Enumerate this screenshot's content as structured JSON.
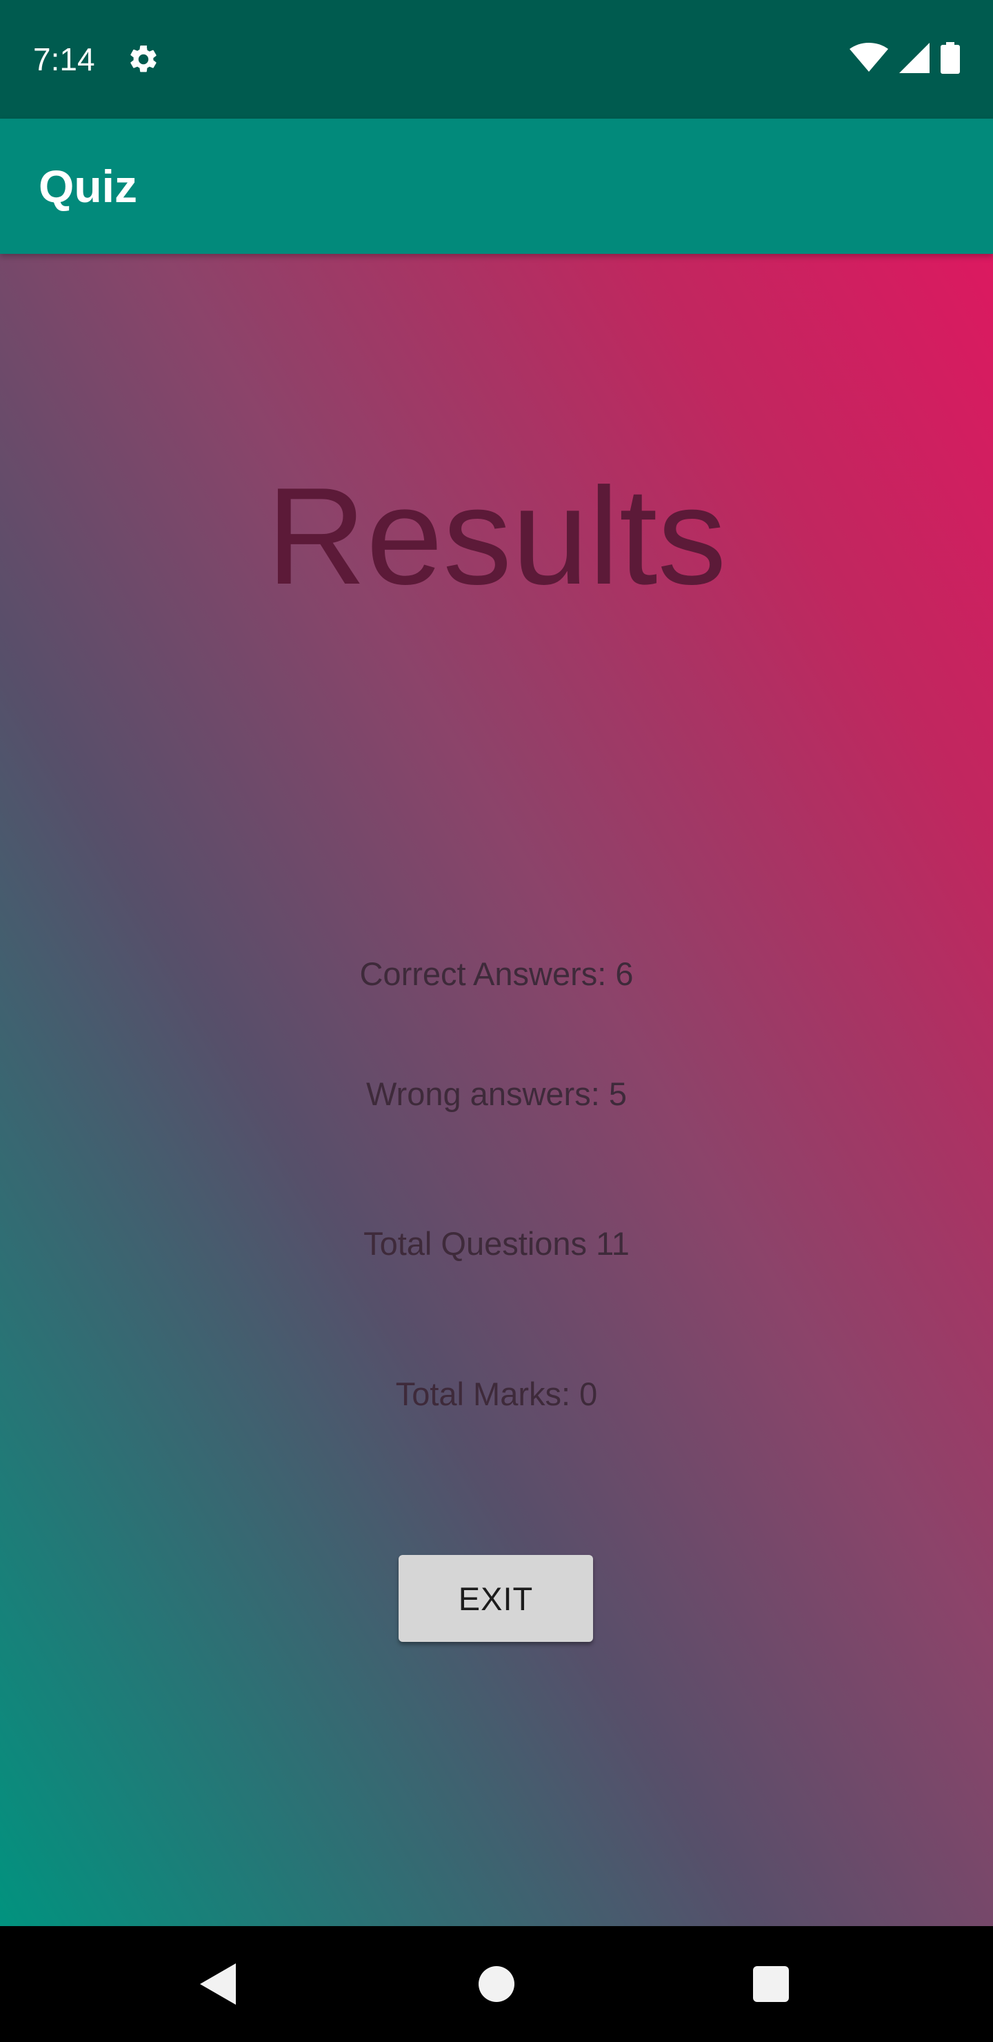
{
  "status_bar": {
    "time": "7:14",
    "icons": [
      "settings-gear-icon",
      "wifi-icon",
      "cell-signal-icon",
      "battery-icon"
    ]
  },
  "app_bar": {
    "title": "Quiz"
  },
  "results": {
    "title": "Results",
    "correct_answers": "Correct Answers: 6",
    "wrong_answers": "Wrong answers: 5",
    "total_questions": "Total Questions 11",
    "total_marks": "Total Marks: 0",
    "exit_label": "EXIT"
  },
  "nav_bar": {
    "icons": [
      "back-icon",
      "home-icon",
      "recents-icon"
    ]
  },
  "colors": {
    "status_bar": "#005b4f",
    "app_bar": "#028a7b",
    "gradient_start": "#01937f",
    "gradient_end": "#dc1960",
    "results_title": "#5c1a38",
    "button": "#d6d6d6"
  }
}
